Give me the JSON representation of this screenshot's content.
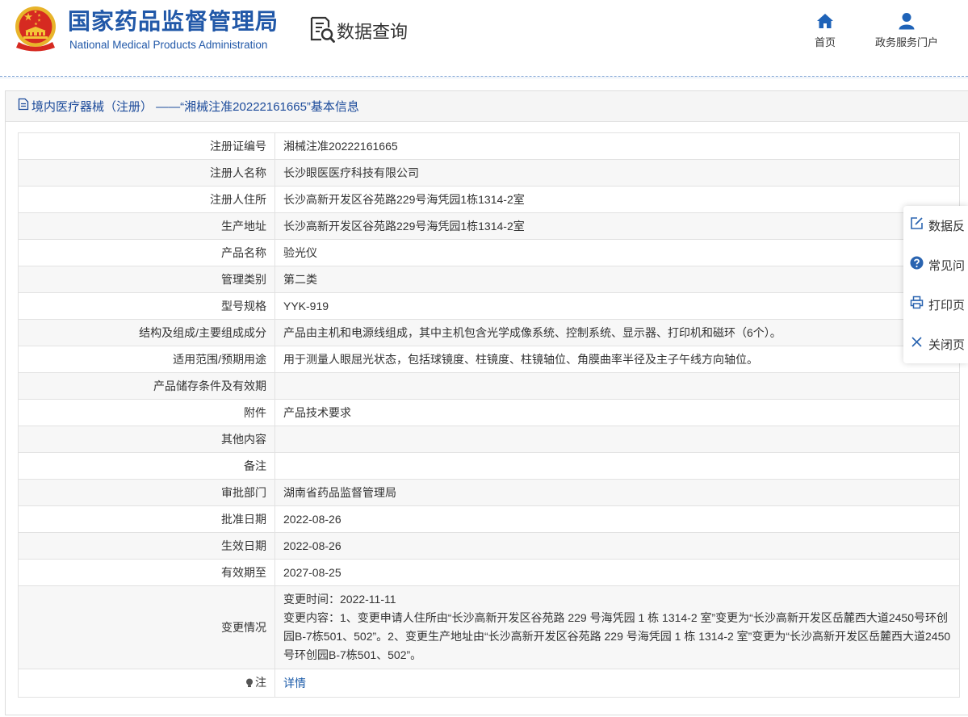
{
  "header": {
    "title": "国家药品监督管理局",
    "subtitle": "National Medical Products Administration",
    "section": "数据查询",
    "nav": [
      {
        "label": "首页",
        "icon": "home-icon"
      },
      {
        "label": "政务服务门户",
        "icon": "user-icon"
      }
    ]
  },
  "panel": {
    "title": "境内医疗器械（注册） ——“湘械注准20222161665”基本信息"
  },
  "table": {
    "rows": [
      {
        "label": "注册证编号",
        "value": "湘械注准20222161665"
      },
      {
        "label": "注册人名称",
        "value": "长沙眼医医疗科技有限公司"
      },
      {
        "label": "注册人住所",
        "value": "长沙高新开发区谷苑路229号海凭园1栋1314-2室"
      },
      {
        "label": "生产地址",
        "value": "长沙高新开发区谷苑路229号海凭园1栋1314-2室"
      },
      {
        "label": "产品名称",
        "value": "验光仪"
      },
      {
        "label": "管理类别",
        "value": "第二类"
      },
      {
        "label": "型号规格",
        "value": "YYK-919"
      },
      {
        "label": "结构及组成/主要组成成分",
        "value": "产品由主机和电源线组成，其中主机包含光学成像系统、控制系统、显示器、打印机和磁环（6个）。"
      },
      {
        "label": "适用范围/预期用途",
        "value": "用于测量人眼屈光状态，包括球镜度、柱镜度、柱镜轴位、角膜曲率半径及主子午线方向轴位。"
      },
      {
        "label": "产品储存条件及有效期",
        "value": ""
      },
      {
        "label": "附件",
        "value": "产品技术要求"
      },
      {
        "label": "其他内容",
        "value": ""
      },
      {
        "label": "备注",
        "value": ""
      },
      {
        "label": "审批部门",
        "value": "湖南省药品监督管理局"
      },
      {
        "label": "批准日期",
        "value": "2022-08-26"
      },
      {
        "label": "生效日期",
        "value": "2022-08-26"
      },
      {
        "label": "有效期至",
        "value": "2027-08-25"
      }
    ]
  },
  "change": {
    "label": "变更情况",
    "time": "变更时间：2022-11-11",
    "content": "变更内容：1、变更申请人住所由“长沙高新开发区谷苑路 229 号海凭园 1 栋 1314-2 室”变更为“长沙高新开发区岳麓西大道2450号环创园B-7栋501、502”。2、变更生产地址由“长沙高新开发区谷苑路 229 号海凭园 1 栋 1314-2 室”变更为“长沙高新开发区岳麓西大道2450号环创园B-7栋501、502”。"
  },
  "note": {
    "label": "注",
    "link": "详情"
  },
  "sidebar": [
    {
      "label": "数据反",
      "icon": "edit-icon"
    },
    {
      "label": "常见问",
      "icon": "question-icon"
    },
    {
      "label": "打印页",
      "icon": "print-icon"
    },
    {
      "label": "关闭页",
      "icon": "close-icon"
    }
  ],
  "colors": {
    "brand_blue": "#2158a8",
    "panel_title": "#1b4a9a",
    "link": "#1a5aa8",
    "icon_blue": "#1f63b8"
  }
}
